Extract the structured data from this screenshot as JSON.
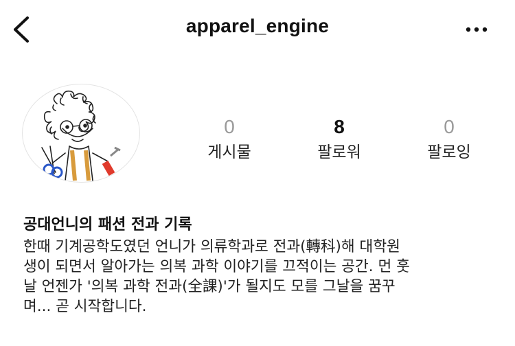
{
  "header": {
    "username": "apparel_engine"
  },
  "profile": {
    "stats": [
      {
        "value": "0",
        "label": "게시물"
      },
      {
        "value": "8",
        "label": "팔로워"
      },
      {
        "value": "0",
        "label": "팔로잉"
      }
    ],
    "name": "공대언니의 패션 전과 기록",
    "bio_lines": [
      "한때 기계공학도였던 언니가 의류학과로 전과(轉科)해 대학원",
      "생이 되면서 알아가는 의복 과학 이야기를 끄적이는 공간. 먼 훗",
      "날 언젠가 '의복 과학 전과(全課)'가 될지도 모를 그날을 꿈꾸",
      "며... 곧 시작합니다."
    ]
  },
  "icons": {
    "back": "chevron-left-icon",
    "more": "more-horizontal-icon"
  }
}
